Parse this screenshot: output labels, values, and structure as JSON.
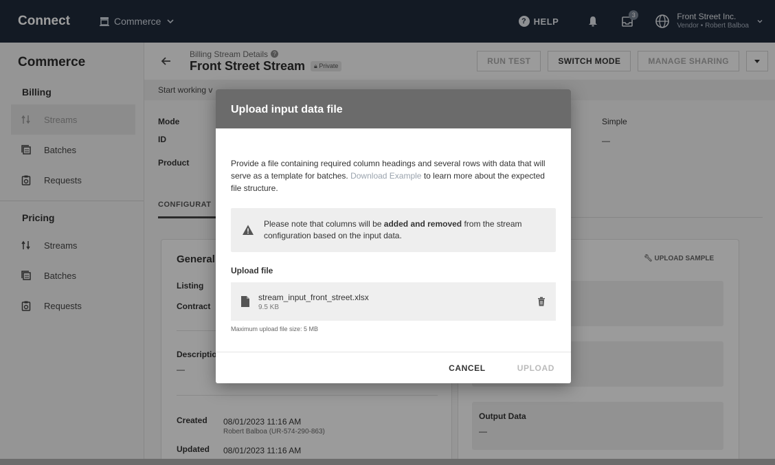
{
  "topbar": {
    "brand": "Connect",
    "module": "Commerce",
    "help": "HELP",
    "notification_count": "3",
    "account_name": "Front Street Inc.",
    "account_sub": "Vendor • Robert Balboa"
  },
  "sidebar": {
    "title": "Commerce",
    "billing_label": "Billing",
    "billing_items": [
      {
        "label": "Streams",
        "icon": "streams-icon"
      },
      {
        "label": "Batches",
        "icon": "batches-icon"
      },
      {
        "label": "Requests",
        "icon": "requests-icon"
      }
    ],
    "pricing_label": "Pricing",
    "pricing_items": [
      {
        "label": "Streams",
        "icon": "streams-icon"
      },
      {
        "label": "Batches",
        "icon": "batches-icon"
      },
      {
        "label": "Requests",
        "icon": "requests-icon"
      }
    ]
  },
  "header": {
    "breadcrumb": "Billing Stream Details",
    "title": "Front Street Stream",
    "badge": "Private",
    "run_test": "RUN TEST",
    "switch_mode": "SWITCH MODE",
    "manage_sharing": "MANAGE SHARING"
  },
  "notice": "Start working v",
  "details": {
    "mode_label": "Mode",
    "id_label": "ID",
    "product_label": "Product",
    "mode_value": "Simple",
    "id_value": "—",
    "config_tab": "CONFIGURAT",
    "general": "General",
    "listing": "Listing",
    "contract": "Contract",
    "description": "Descriptio",
    "description_value": "—",
    "created_label": "Created",
    "created_value": "08/01/2023 11:16 AM",
    "created_by": "Robert Balboa (UR-574-290-863)",
    "updated_label": "Updated",
    "updated_value": "08/01/2023 11:16 AM",
    "upload_sample": "UPLOAD SAMPLE",
    "output_data": "Output Data",
    "output_value": "—"
  },
  "modal": {
    "title": "Upload input data file",
    "desc_before": "Provide a file containing required column headings and several rows with data that will serve as a template for batches. ",
    "desc_link": "Download Example",
    "desc_after": " to learn more about the expected file structure.",
    "warn_before": "Please note that columns will be ",
    "warn_bold": "added and removed",
    "warn_after": " from the stream configuration based on the input data.",
    "upload_label": "Upload file",
    "file_name": "stream_input_front_street.xlsx",
    "file_size": "9.5 KB",
    "max_note": "Maximum upload file size: 5 MB",
    "cancel": "CANCEL",
    "upload": "UPLOAD"
  }
}
